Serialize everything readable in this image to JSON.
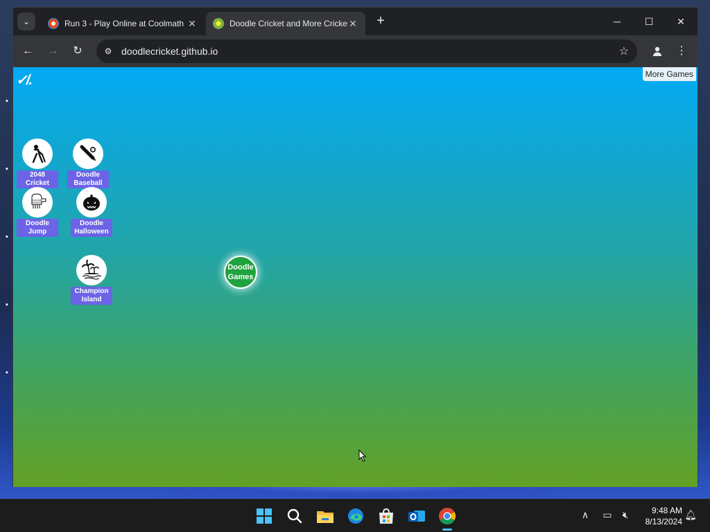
{
  "browser": {
    "tabs": [
      {
        "title": "Run 3 - Play Online at Coolmath",
        "active": false,
        "favicon": "coolmath-icon"
      },
      {
        "title": "Doodle Cricket and More Cricket",
        "active": true,
        "favicon": "doodle-cricket-icon"
      }
    ],
    "url": "doodlecricket.github.io"
  },
  "page": {
    "logo": "✓/.",
    "more_games": "More Games",
    "games": [
      {
        "label": "2048 Cricket",
        "icon": "cricket-player-icon"
      },
      {
        "label": "Doodle Baseball",
        "icon": "baseball-bat-icon"
      },
      {
        "label": "Doodle Jump",
        "icon": "doodle-jumper-icon"
      },
      {
        "label": "Doodle Halloween",
        "icon": "pumpkin-icon"
      },
      {
        "label": "Champion Island",
        "icon": "island-icon"
      }
    ],
    "center_button": "Doodle Games",
    "gradient": {
      "top": "#03a9f4",
      "bottom": "#63a124"
    }
  },
  "taskbar": {
    "time": "9:48 AM",
    "date": "8/13/2024",
    "apps": [
      "start-icon",
      "search-icon",
      "file-explorer-icon",
      "edge-icon",
      "store-icon",
      "outlook-icon",
      "chrome-icon"
    ]
  }
}
